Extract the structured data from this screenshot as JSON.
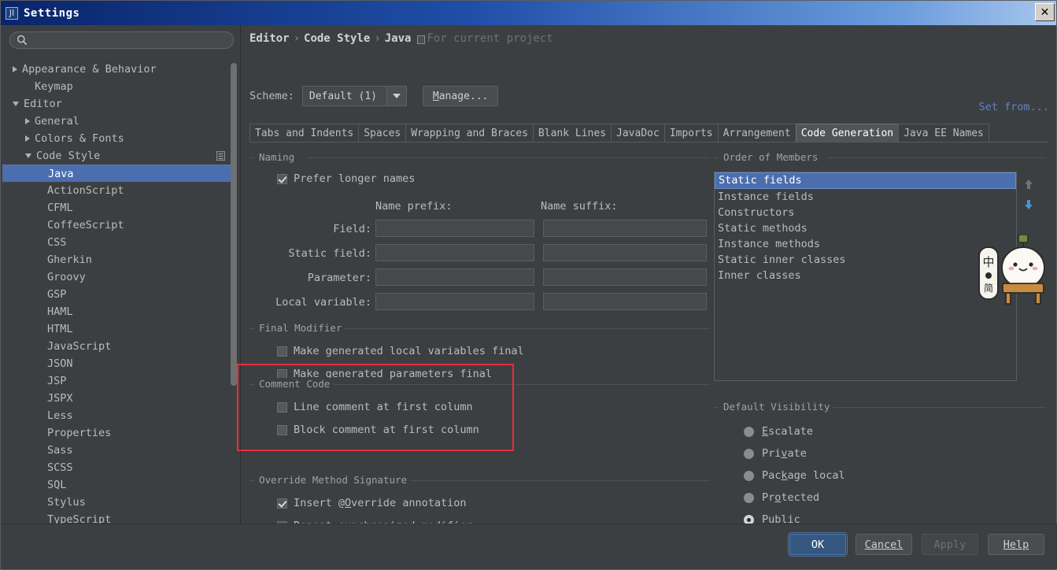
{
  "window": {
    "title": "Settings",
    "icon": "intellij-idea-icon",
    "close_label": "✕"
  },
  "sidebar": {
    "search": {
      "placeholder": "",
      "value": "",
      "icon": "search-icon"
    },
    "items": [
      {
        "label": "Appearance & Behavior",
        "indent": 0,
        "arrow": "closed",
        "selected": false
      },
      {
        "label": "Keymap",
        "indent": 1,
        "arrow": "none",
        "selected": false
      },
      {
        "label": "Editor",
        "indent": 0,
        "arrow": "open",
        "selected": false
      },
      {
        "label": "General",
        "indent": 1,
        "arrow": "closed",
        "selected": false
      },
      {
        "label": "Colors & Fonts",
        "indent": 1,
        "arrow": "closed",
        "selected": false
      },
      {
        "label": "Code Style",
        "indent": 1,
        "arrow": "open",
        "selected": false,
        "icon": "copy-settings-icon"
      },
      {
        "label": "Java",
        "indent": 2,
        "arrow": "none",
        "selected": true
      },
      {
        "label": "ActionScript",
        "indent": 2,
        "arrow": "none",
        "selected": false
      },
      {
        "label": "CFML",
        "indent": 2,
        "arrow": "none",
        "selected": false
      },
      {
        "label": "CoffeeScript",
        "indent": 2,
        "arrow": "none",
        "selected": false
      },
      {
        "label": "CSS",
        "indent": 2,
        "arrow": "none",
        "selected": false
      },
      {
        "label": "Gherkin",
        "indent": 2,
        "arrow": "none",
        "selected": false
      },
      {
        "label": "Groovy",
        "indent": 2,
        "arrow": "none",
        "selected": false
      },
      {
        "label": "GSP",
        "indent": 2,
        "arrow": "none",
        "selected": false
      },
      {
        "label": "HAML",
        "indent": 2,
        "arrow": "none",
        "selected": false
      },
      {
        "label": "HTML",
        "indent": 2,
        "arrow": "none",
        "selected": false
      },
      {
        "label": "JavaScript",
        "indent": 2,
        "arrow": "none",
        "selected": false
      },
      {
        "label": "JSON",
        "indent": 2,
        "arrow": "none",
        "selected": false
      },
      {
        "label": "JSP",
        "indent": 2,
        "arrow": "none",
        "selected": false
      },
      {
        "label": "JSPX",
        "indent": 2,
        "arrow": "none",
        "selected": false
      },
      {
        "label": "Less",
        "indent": 2,
        "arrow": "none",
        "selected": false
      },
      {
        "label": "Properties",
        "indent": 2,
        "arrow": "none",
        "selected": false
      },
      {
        "label": "Sass",
        "indent": 2,
        "arrow": "none",
        "selected": false
      },
      {
        "label": "SCSS",
        "indent": 2,
        "arrow": "none",
        "selected": false
      },
      {
        "label": "SQL",
        "indent": 2,
        "arrow": "none",
        "selected": false
      },
      {
        "label": "Stylus",
        "indent": 2,
        "arrow": "none",
        "selected": false
      },
      {
        "label": "TypeScript",
        "indent": 2,
        "arrow": "none",
        "selected": false
      }
    ]
  },
  "breadcrumb": {
    "parts": [
      "Editor",
      "Code Style",
      "Java"
    ],
    "separator": "›",
    "project_scope": "For current project",
    "project_icon": "project-scope-icon"
  },
  "scheme": {
    "label": "Scheme:",
    "value": "Default (1)",
    "dropdown_icon": "chevron-down-icon",
    "manage_label": "Manage...",
    "set_from_label": "Set from..."
  },
  "tabs": [
    {
      "label": "Tabs and Indents",
      "active": false
    },
    {
      "label": "Spaces",
      "active": false
    },
    {
      "label": "Wrapping and Braces",
      "active": false
    },
    {
      "label": "Blank Lines",
      "active": false
    },
    {
      "label": "JavaDoc",
      "active": false
    },
    {
      "label": "Imports",
      "active": false
    },
    {
      "label": "Arrangement",
      "active": false
    },
    {
      "label": "Code Generation",
      "active": true
    },
    {
      "label": "Java EE Names",
      "active": false
    }
  ],
  "naming": {
    "title": "Naming",
    "prefer_longer_names": {
      "label": "Prefer longer names",
      "checked": true
    },
    "col_prefix": "Name prefix:",
    "col_suffix": "Name suffix:",
    "rows": [
      {
        "label": "Field:",
        "prefix": "",
        "suffix": ""
      },
      {
        "label": "Static field:",
        "prefix": "",
        "suffix": ""
      },
      {
        "label": "Parameter:",
        "prefix": "",
        "suffix": ""
      },
      {
        "label": "Local variable:",
        "prefix": "",
        "suffix": ""
      }
    ]
  },
  "final_modifier": {
    "title": "Final Modifier",
    "options": [
      {
        "label": "Make generated local variables final",
        "checked": false
      },
      {
        "label": "Make generated parameters final",
        "checked": false
      }
    ]
  },
  "comment_code": {
    "title": "Comment Code",
    "highlight_color": "#ee2b3c",
    "options": [
      {
        "label": "Line comment at first column",
        "checked": false
      },
      {
        "label": "Block comment at first column",
        "checked": false
      }
    ]
  },
  "override_method_signature": {
    "title": "Override Method Signature",
    "options": [
      {
        "label": "Insert @Override annotation",
        "checked": true,
        "mnemonic": "O"
      },
      {
        "label": "Repeat synchronized modifier",
        "checked": true,
        "mnemonic": "s"
      }
    ]
  },
  "order_of_members": {
    "title": "Order of Members",
    "items": [
      {
        "label": "Static fields",
        "selected": true
      },
      {
        "label": "Instance fields",
        "selected": false
      },
      {
        "label": "Constructors",
        "selected": false
      },
      {
        "label": "Static methods",
        "selected": false
      },
      {
        "label": "Instance methods",
        "selected": false
      },
      {
        "label": "Static inner classes",
        "selected": false
      },
      {
        "label": "Inner classes",
        "selected": false
      }
    ],
    "move_up_icon": "arrow-up-icon",
    "move_down_icon": "arrow-down-icon",
    "move_up_enabled": false,
    "move_down_enabled": true
  },
  "default_visibility": {
    "title": "Default Visibility",
    "options": [
      {
        "label": "Escalate",
        "mnemonic": "E",
        "selected": false
      },
      {
        "label": "Private",
        "mnemonic": "v",
        "selected": false
      },
      {
        "label": "Package local",
        "mnemonic": "k",
        "selected": false
      },
      {
        "label": "Protected",
        "mnemonic": "o",
        "selected": false
      },
      {
        "label": "Public",
        "mnemonic": "b",
        "selected": true
      }
    ]
  },
  "footer": {
    "ok": "OK",
    "cancel": "Cancel",
    "apply": "Apply",
    "help": "Help",
    "apply_enabled": false
  },
  "overlay": {
    "mascot": "mascot-sticker"
  },
  "colors": {
    "accent_selection": "#4b6eaf",
    "window_bg": "#3c3f41",
    "text": "#bbbbbb",
    "link": "#5e83c4",
    "highlight": "#ee2b3c"
  }
}
